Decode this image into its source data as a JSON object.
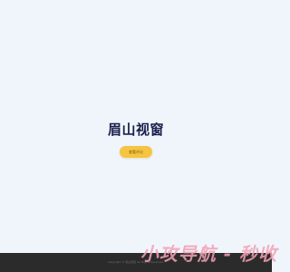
{
  "hero": {
    "title": "眉山视窗",
    "enter_label": "查看评论"
  },
  "footer": {
    "copyright": "Copyright © 眉山视窗 All Rights Reserved."
  },
  "overlay": {
    "watermark": "小攻导航 - 秒收"
  },
  "colors": {
    "background": "#f0f5fc",
    "title": "#1a1f4b",
    "button": "#f5c542",
    "footer": "#2b2b2b",
    "watermark": "#f3a1b4"
  }
}
